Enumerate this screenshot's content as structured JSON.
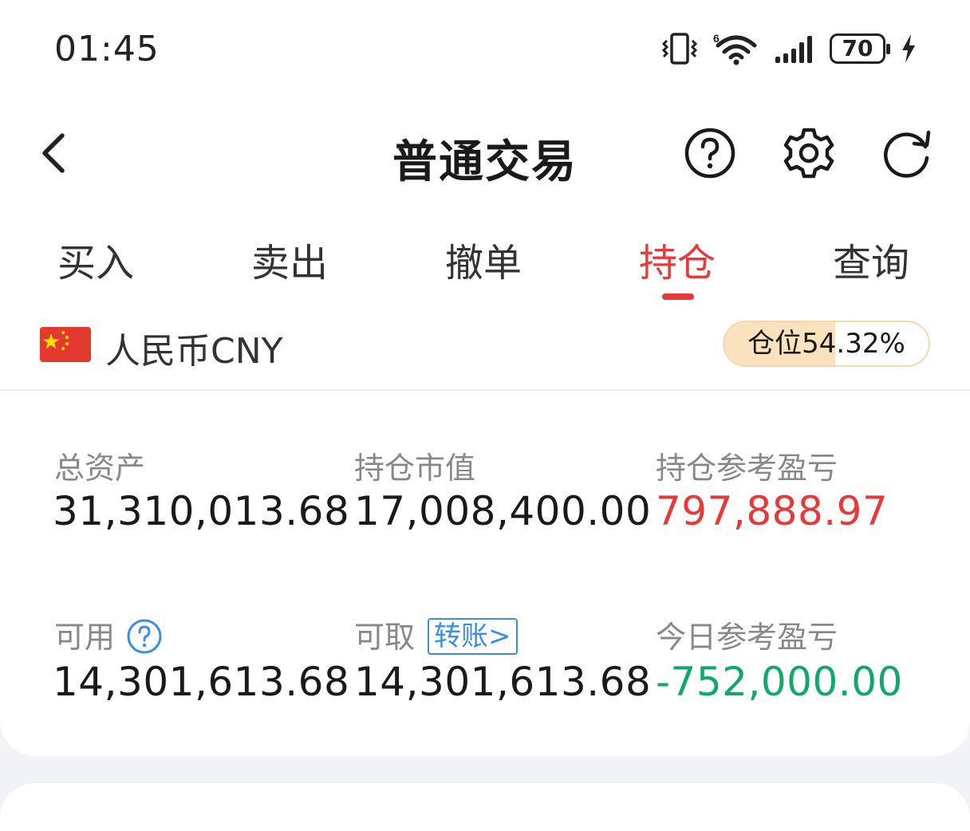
{
  "status_bar": {
    "time": "01:45",
    "battery": "70",
    "network": "6"
  },
  "header": {
    "title": "普通交易"
  },
  "icons": {
    "back": "chevron-left-icon",
    "help": "question-circle-icon",
    "settings": "gear-icon",
    "refresh": "refresh-icon"
  },
  "tabs": [
    {
      "label": "买入",
      "active": false
    },
    {
      "label": "卖出",
      "active": false
    },
    {
      "label": "撤单",
      "active": false
    },
    {
      "label": "持仓",
      "active": true
    },
    {
      "label": "查询",
      "active": false
    }
  ],
  "currency": {
    "label": "人民币CNY",
    "flag": "china-flag"
  },
  "position": {
    "label": "仓位54.32%",
    "ratio": 0.5432
  },
  "stats": {
    "total_assets": {
      "label": "总资产",
      "value": "31,310,013.68"
    },
    "market_value": {
      "label": "持仓市值",
      "value": "17,008,400.00"
    },
    "position_pnl": {
      "label": "持仓参考盈亏",
      "value": "797,888.97"
    },
    "available": {
      "label": "可用",
      "value": "14,301,613.68"
    },
    "withdrawable": {
      "label": "可取",
      "value": "14,301,613.68",
      "transfer_label": "转账>"
    },
    "today_pnl": {
      "label": "今日参考盈亏",
      "value": "-752,000.00"
    }
  },
  "colors": {
    "accent_red": "#e8393a",
    "gain_green": "#13a86b",
    "link_blue": "#3a8ee6",
    "pill_fill": "#fbe2bf"
  }
}
